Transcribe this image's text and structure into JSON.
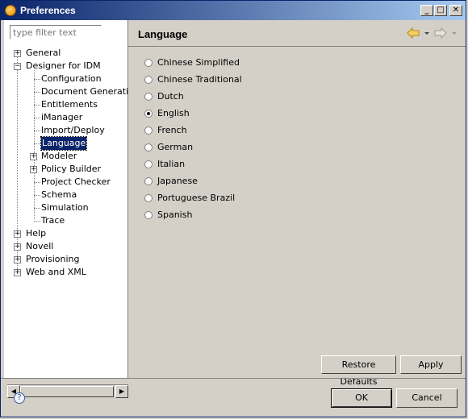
{
  "window": {
    "title": "Preferences",
    "minimize_label": "_",
    "maximize_label": "□",
    "close_label": "✕"
  },
  "left": {
    "filter_placeholder": "type filter text",
    "tree": [
      {
        "label": "General",
        "expander": "+"
      },
      {
        "label": "Designer for IDM",
        "expander": "−"
      },
      {
        "label": "Configuration"
      },
      {
        "label": "Document Generation"
      },
      {
        "label": "Entitlements"
      },
      {
        "label": "iManager"
      },
      {
        "label": "Import/Deploy"
      },
      {
        "label": "Language",
        "selected": true
      },
      {
        "label": "Modeler",
        "expander": "+"
      },
      {
        "label": "Policy Builder",
        "expander": "+"
      },
      {
        "label": "Project Checker"
      },
      {
        "label": "Schema"
      },
      {
        "label": "Simulation"
      },
      {
        "label": "Trace"
      },
      {
        "label": "Help",
        "expander": "+"
      },
      {
        "label": "Novell",
        "expander": "+"
      },
      {
        "label": "Provisioning",
        "expander": "+"
      },
      {
        "label": "Web and XML",
        "expander": "+"
      }
    ]
  },
  "right": {
    "title": "Language",
    "languages": [
      {
        "label": "Chinese Simplified",
        "checked": false
      },
      {
        "label": "Chinese Traditional",
        "checked": false
      },
      {
        "label": "Dutch",
        "checked": false
      },
      {
        "label": "English",
        "checked": true
      },
      {
        "label": "French",
        "checked": false
      },
      {
        "label": "German",
        "checked": false
      },
      {
        "label": "Italian",
        "checked": false
      },
      {
        "label": "Japanese",
        "checked": false
      },
      {
        "label": "Portuguese Brazil",
        "checked": false
      },
      {
        "label": "Spanish",
        "checked": false
      }
    ],
    "restore_defaults_label": "Restore Defaults",
    "apply_label": "Apply"
  },
  "footer": {
    "ok_label": "OK",
    "cancel_label": "Cancel",
    "help_label": "?"
  },
  "colors": {
    "titlebar": "#0a246a",
    "selection": "#0a246a",
    "nav_arrow": "#e8b010"
  }
}
